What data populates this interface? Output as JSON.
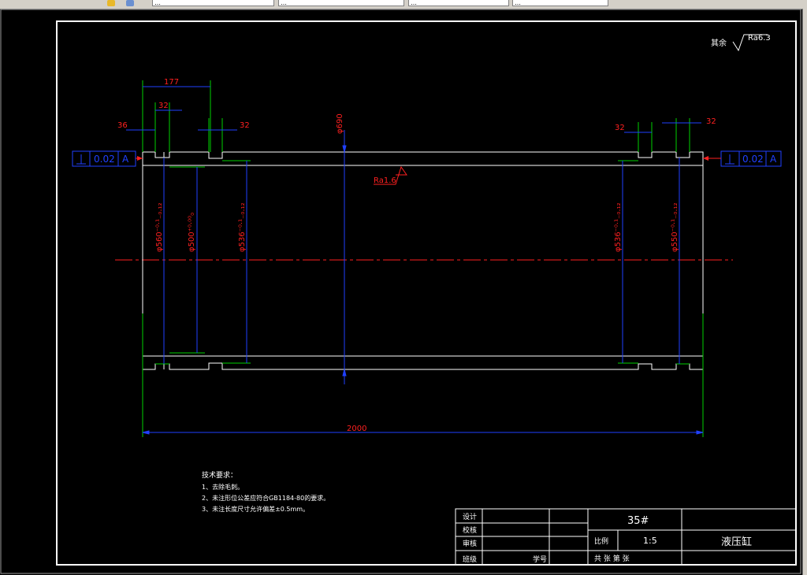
{
  "toolbar": {
    "box1": "…",
    "box2": "…",
    "box3": "…",
    "box4": "…"
  },
  "drawing": {
    "surface_note": {
      "prefix": "其余",
      "value": "Ra6.3"
    },
    "roughness_inner": "Ra1.6",
    "geo_tolerance_left": {
      "value": "0.02",
      "datum": "A"
    },
    "geo_tolerance_right": {
      "value": "0.02",
      "datum": "A"
    },
    "dims": {
      "d177": "177",
      "d32_top_left": "32",
      "d36": "36",
      "d32_left_groove": "32",
      "d32_right_groove": "32",
      "d32_top_right": "32",
      "d690": "φ690",
      "d560_left": "φ560⁻⁰·¹₋₀.₁₂",
      "d500": "φ500⁺⁰·⁰⁰₀",
      "d536_left": "φ536⁻⁰·¹₋₀.₁₂",
      "d536_right": "φ536⁻⁰·¹₋₀.₁₂",
      "d550_right": "φ550⁻⁰·¹₋₀.₁₂",
      "d2000": "2000"
    },
    "tech_req": {
      "title": "技术要求：",
      "items": [
        "1、去除毛刺。",
        "2、未注形位公差应符合GB1184-80的要求。",
        "3、未注长度尺寸允许偏差±0.5mm。"
      ]
    },
    "title_block": {
      "design": "设计",
      "proof": "校核",
      "review": "审核",
      "class": "班级",
      "student_no": "学号",
      "material": "35#",
      "scale_label": "比例",
      "scale_value": "1:5",
      "part_name": "液压缸",
      "sheets": "共    张    第    张"
    }
  }
}
